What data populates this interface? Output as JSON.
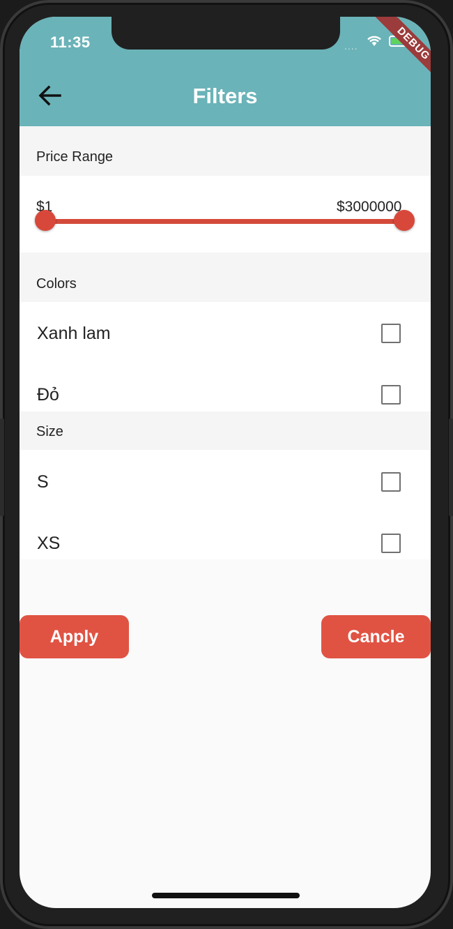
{
  "status_bar": {
    "time": "11:35",
    "signal_dots": "....",
    "icons": [
      "wifi-icon",
      "battery-icon"
    ],
    "battery_level": 0.8
  },
  "debug_banner": "DEBUG",
  "app_bar": {
    "title": "Filters",
    "back_icon": "arrow-left-icon",
    "color": "#6ab3b8"
  },
  "price_range": {
    "header": "Price Range",
    "min_label": "$1",
    "max_label": "$3000000",
    "min_value": 1,
    "max_value": 3000000,
    "accent": "#d8483a"
  },
  "colors": {
    "header": "Colors",
    "options": [
      {
        "label": "Xanh lam",
        "checked": false
      },
      {
        "label": "Đỏ",
        "checked": false
      }
    ]
  },
  "size": {
    "header": "Size",
    "options": [
      {
        "label": "S",
        "checked": false
      },
      {
        "label": "XS",
        "checked": false
      }
    ]
  },
  "actions": {
    "apply_label": "Apply",
    "cancel_label": "Cancle",
    "button_color": "#e05343"
  }
}
